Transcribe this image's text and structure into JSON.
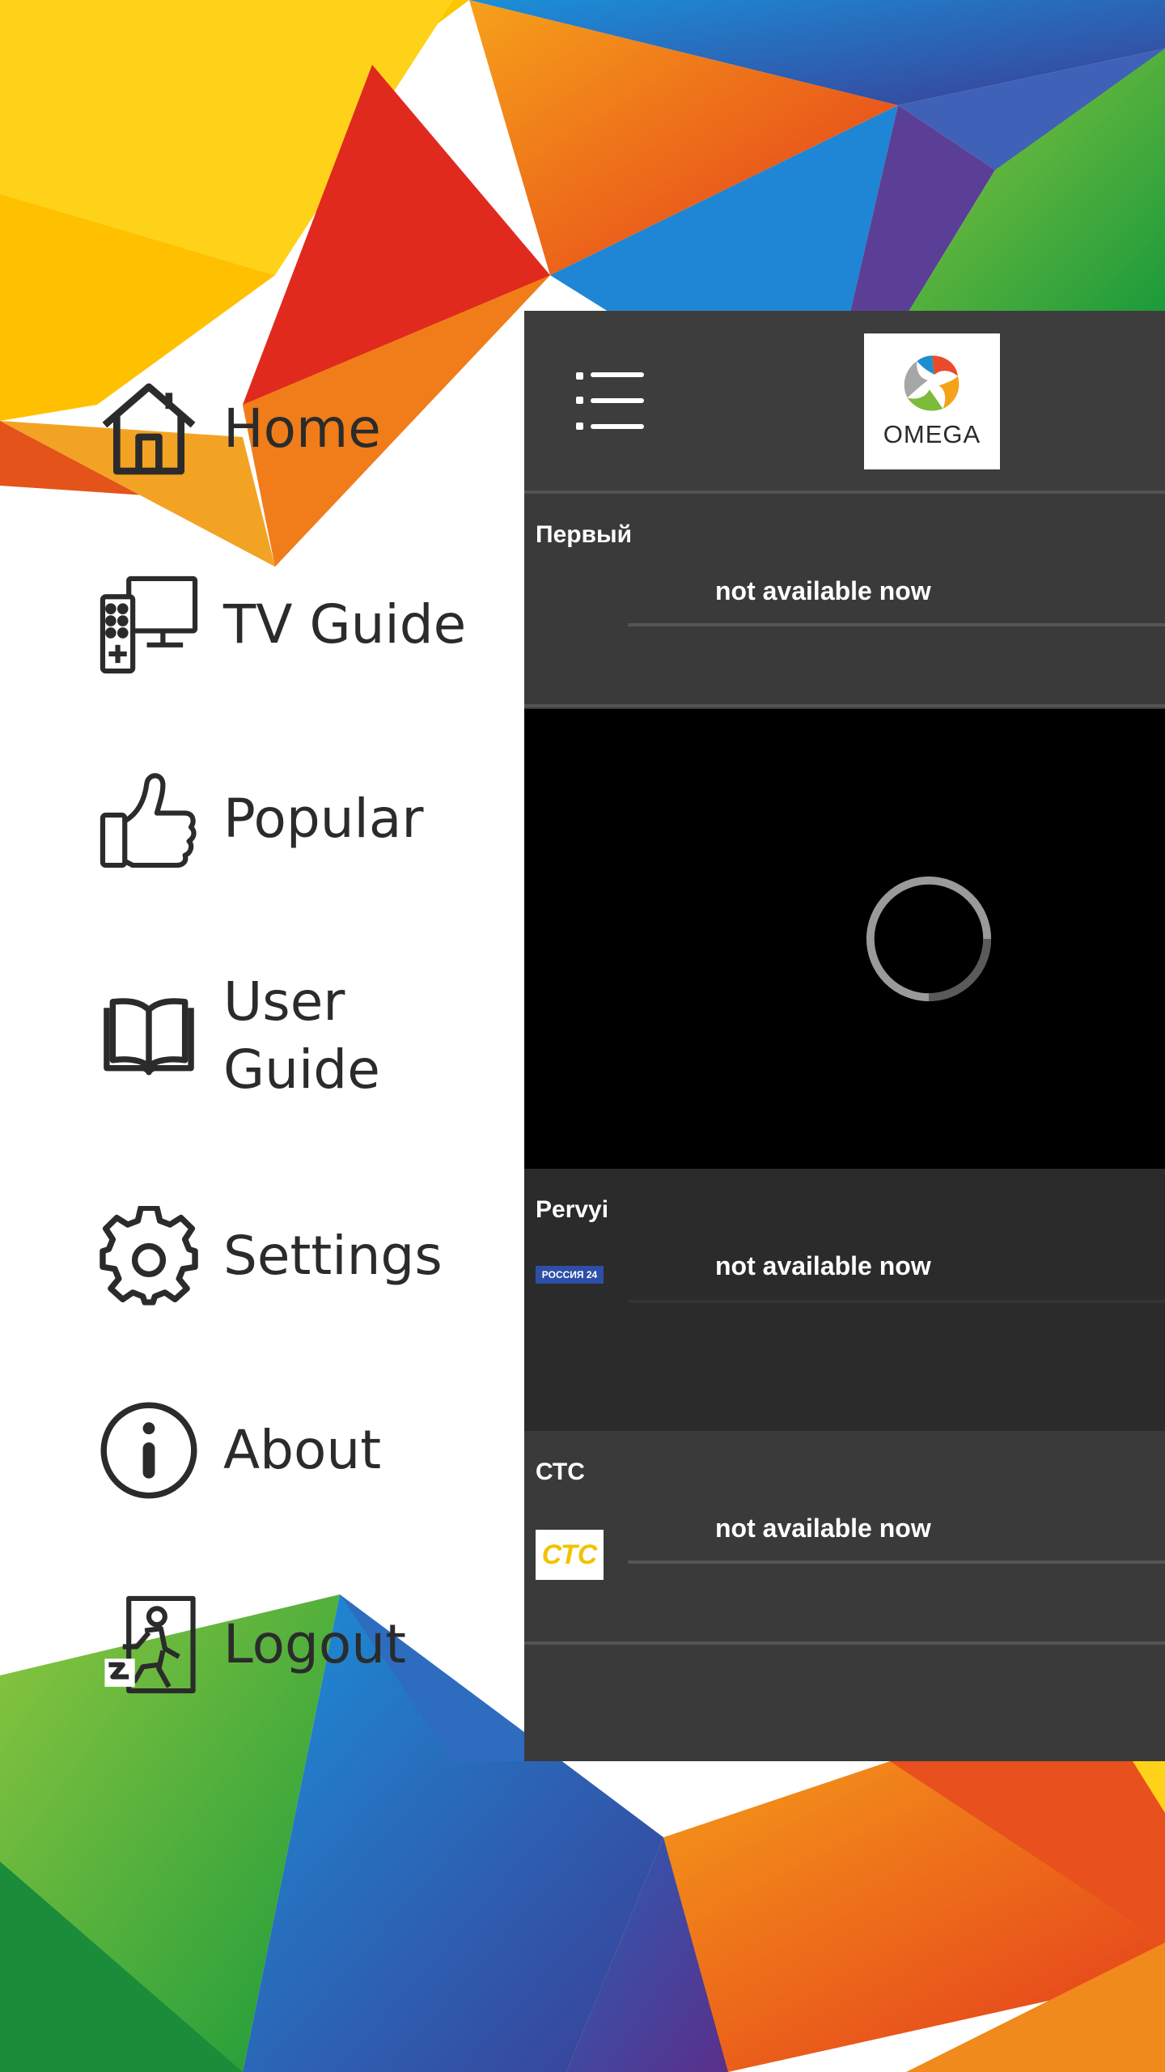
{
  "menu": {
    "items": [
      {
        "label": "Home",
        "icon": "home-icon"
      },
      {
        "label": "TV Guide",
        "icon": "tv-remote-icon"
      },
      {
        "label": "Popular",
        "icon": "thumbs-up-icon"
      },
      {
        "label": "User Guide",
        "icon": "book-icon"
      },
      {
        "label": "Settings",
        "icon": "gear-icon"
      },
      {
        "label": "About",
        "icon": "info-icon"
      },
      {
        "label": "Logout",
        "icon": "exit-icon"
      }
    ]
  },
  "header": {
    "menu_icon": "hamburger-menu-icon",
    "logo_text": "OMEGA"
  },
  "channels": [
    {
      "name": "Первый",
      "status": "not available now",
      "logo": ""
    },
    {
      "name": "Pervyi",
      "status": "not available now",
      "logo": "РОССИЯ 24"
    },
    {
      "name": "СТС",
      "status": "not available now",
      "logo": "СТС"
    }
  ],
  "colors": {
    "panel_bg": "#3a3a3a",
    "video_bg": "#000000",
    "menu_text": "#2b2b2b",
    "ctc_logo": "#f2c200",
    "rossiya_logo": "#2e4fa8"
  }
}
